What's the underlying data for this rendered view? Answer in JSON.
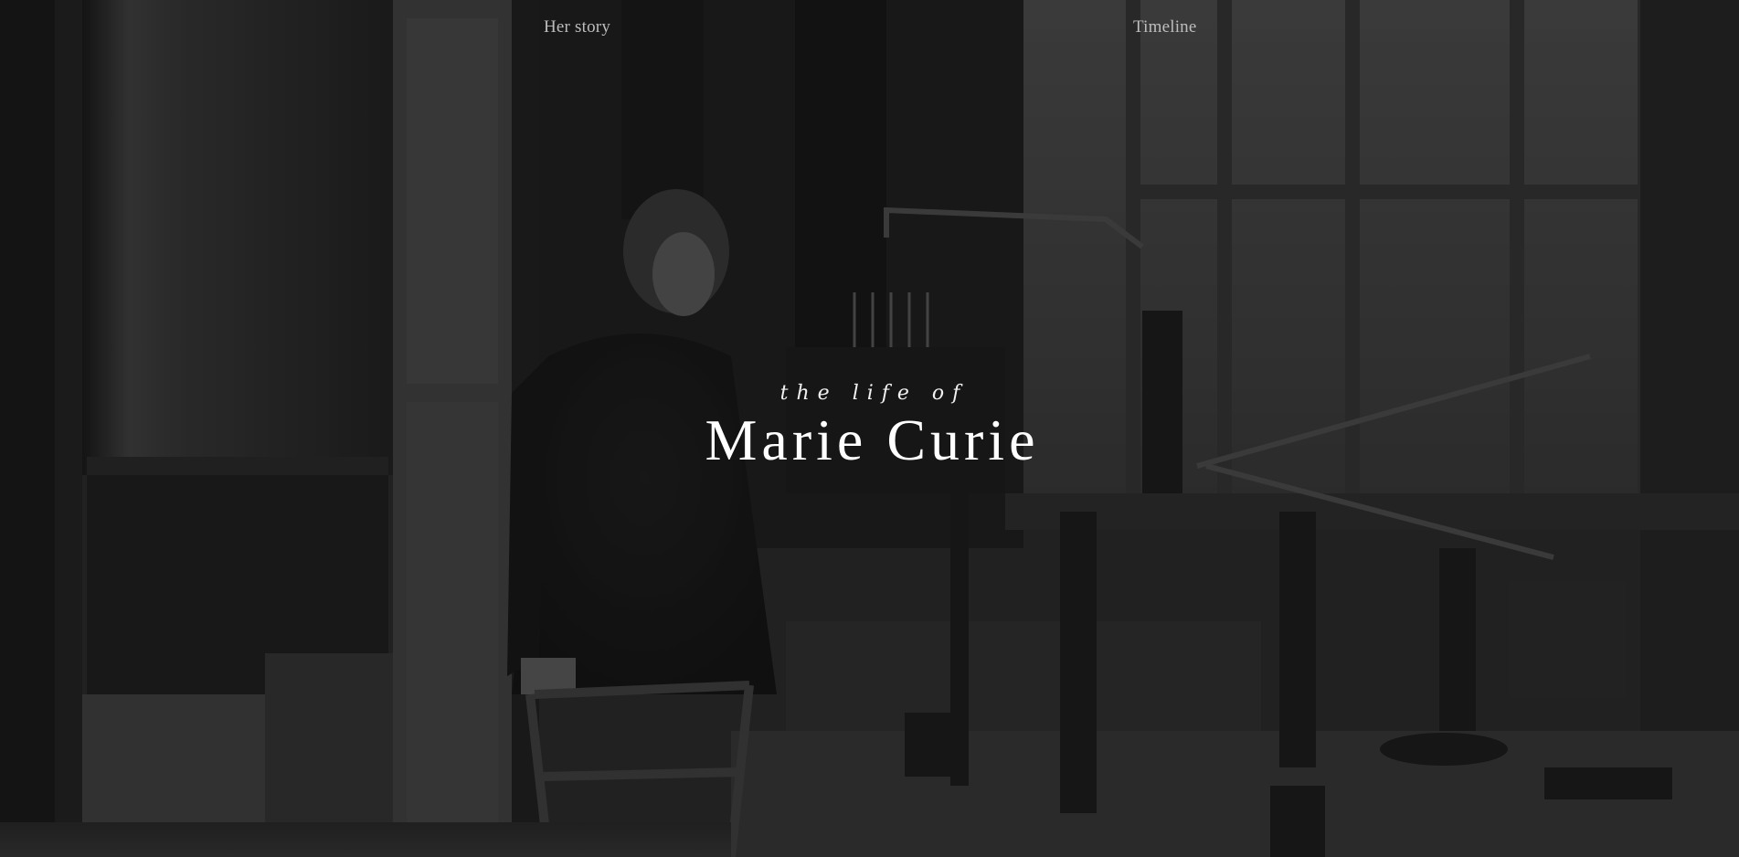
{
  "nav": {
    "items": [
      {
        "label": "Her story"
      },
      {
        "label": "Timeline"
      }
    ]
  },
  "hero": {
    "subtitle": "the life of",
    "title": "Marie Curie",
    "background_description_icon": "lab-photo-image"
  },
  "colors": {
    "overlay": "#141414",
    "nav_text": "#bdbdbd",
    "title_text": "#ffffff"
  }
}
